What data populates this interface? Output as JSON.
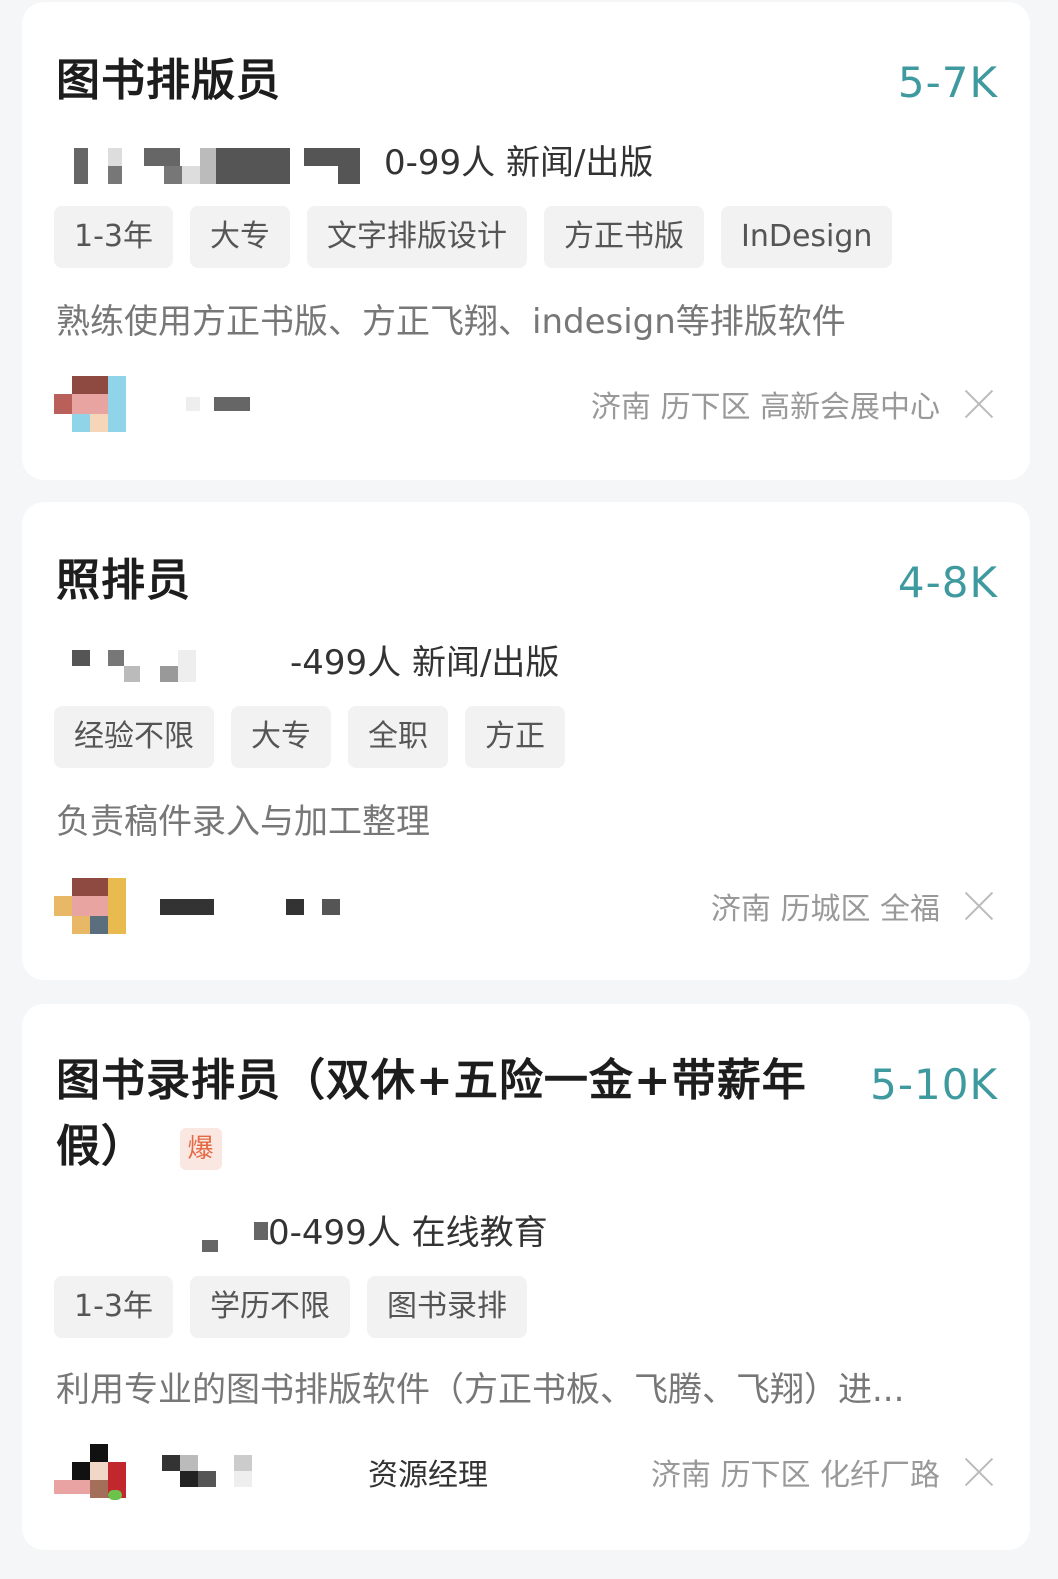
{
  "jobs": [
    {
      "title": "图书排版员",
      "salary": "5-7K",
      "company_info": "0-99人 新闻/出版",
      "tags": [
        "1-3年",
        "大专",
        "文字排版设计",
        "方正书版",
        "InDesign"
      ],
      "description": "熟练使用方正书版、方正飞翔、indesign等排版软件",
      "location": "济南 历下区 高新会展中心"
    },
    {
      "title": "照排员",
      "salary": "4-8K",
      "company_info": "-499人 新闻/出版",
      "tags": [
        "经验不限",
        "大专",
        "全职",
        "方正"
      ],
      "description": "负责稿件录入与加工整理",
      "location": "济南 历城区 全福"
    },
    {
      "title_line1": "图书录排员（双休+五险一金+带薪年",
      "title_line2": "假）",
      "badge": "爆",
      "salary": "5-10K",
      "company_info": "0-499人 在线教育",
      "tags": [
        "1-3年",
        "学历不限",
        "图书录排"
      ],
      "description": "利用专业的图书排版软件（方正书板、飞腾、飞翔）进...",
      "recruiter_title": "资源经理",
      "location": "济南 历下区 化纤厂路"
    }
  ],
  "colors": {
    "salary": "#3f9aa0",
    "badge": "#e36a45",
    "background": "#f5f6f8"
  },
  "icons": [
    "close-icon"
  ]
}
